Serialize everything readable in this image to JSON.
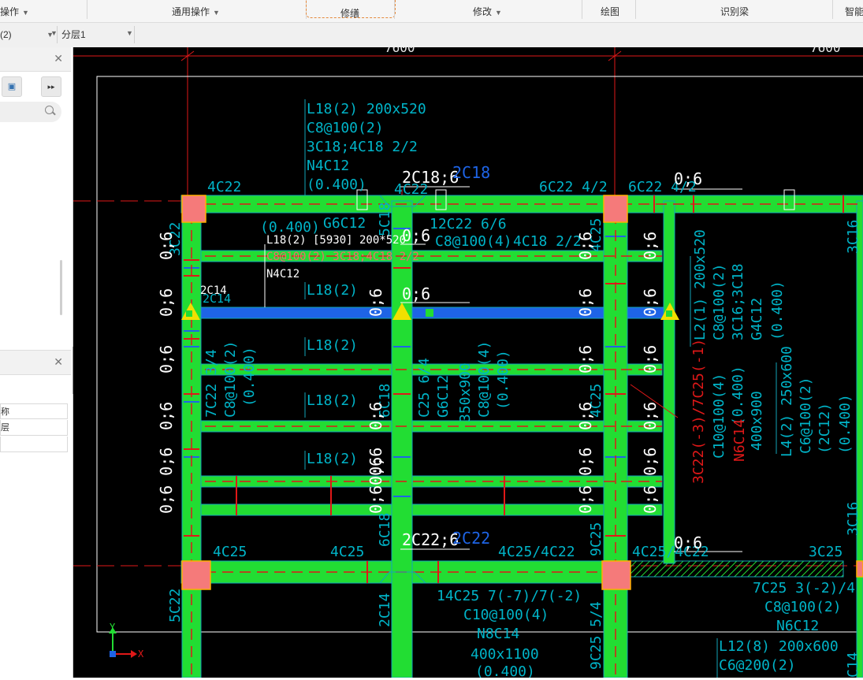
{
  "ribbon": {
    "groups": [
      {
        "label": "操作",
        "caret": true
      },
      {
        "label": "通用操作",
        "caret": true
      },
      {
        "label": "修缮",
        "caret": false
      },
      {
        "label": "修改",
        "caret": true
      },
      {
        "label": "绘图",
        "caret": false
      },
      {
        "label": "识别梁",
        "caret": false
      },
      {
        "label": "智能",
        "caret": false
      }
    ]
  },
  "toolbar": {
    "combo1_value": "(2)",
    "combo2_value": "分层1"
  },
  "left_panel": {
    "table_rows": [
      "称",
      "层",
      ""
    ]
  },
  "drawing": {
    "dims": {
      "left": "7600",
      "right": "7600"
    },
    "texts": {
      "t_l18_200x520": "L18(2) 200x520",
      "t_c8_100_2": "C8@100(2)",
      "t_3c18_4c18": "3C18;4C18 2/2",
      "t_n4c12": "N4C12",
      "t_0400_a": "(0.400)",
      "t_4c22_a": "4C22",
      "t_2c18_6": "2C18;6",
      "t_2c18_blue": "2C18",
      "t_4c22_b": "4C22",
      "t_6c22_42": "6C22 4/2",
      "t_6c22_42b": "6C22 4/2",
      "t_06_top": "0;6",
      "t_0400_b": "(0.400)",
      "t_g6c12": "G6C12",
      "t_12c22": "12C22 6/6",
      "t_c8_100_4": "C8@100(4)",
      "t_4c18_22": "4C18 2/2",
      "t_06_mid": "0;6",
      "t_hover_1": "L18(2) [5930] 200*520",
      "t_hover_2": "C8@100(2) 3C18;4C18 2/2",
      "t_hover_3": "N4C12",
      "t_2c14": "2C14",
      "t_2c14b": "2C14",
      "t_l18_a": "L18(2)",
      "t_06_blue": "0;6",
      "t_l18_b": "L18(2)",
      "t_l18_c": "L18(2)",
      "t_l18_d": "L18(2)",
      "t_7c22": "7C22 3/4",
      "t_c8_100_2b": "C8@100(2)",
      "t_0400_c": "(0.400)",
      "t_c25_64": "C25 6/4",
      "t_g6c12b": "G6C12",
      "t_350x900": "350x900",
      "t_c8_100_4b": "C8@100(4)",
      "t_0400_d": "(0.400)",
      "t_l2": "L2(1) 200x520",
      "t_c8_100_2c": "C8@100(2)",
      "t_3c16": "3C16;3C18",
      "t_g4c12": "G4C12",
      "t_0400_e": "(0.400)",
      "t_3c22": "3C22(-3)/7C25(-1)",
      "t_c10": "C10@100(4)",
      "t_n6c14": "N6C14",
      "t_0400_f": "(0.400)",
      "t_400x900": "400x900",
      "t_l4": "L4(2) 250x600",
      "t_c6_100": "C6@100(2)",
      "t_2c12": "(2C12)",
      "t_0400_g": "(0.400)",
      "t_3c16_r": "3C16",
      "t_3c16_r2": "3C16",
      "t_4c25_a": "4C25",
      "t_4c25_b": "4C25",
      "t_2c22_6": "2C22;6",
      "t_2c22_blue": "2C22",
      "t_4c25_4c22": "4C25/4C22",
      "t_4c25_4c22b": "4C25/4C22",
      "t_06_bot": "0;6",
      "t_3c25": "3C25",
      "t_14c25": "14C25 7(-7)/7(-2)",
      "t_c10b": "C10@100(4)",
      "t_n8c14": "N8C14",
      "t_400x1100": "400x1100",
      "t_0400_h": "(0.400)",
      "t_7c25": "7C25 3(-2)/4",
      "t_c8_100_2d": "C8@100(2)",
      "t_n6c12": "N6C12",
      "t_l12": "L12(8) 200x600",
      "t_c6_200": "C6@200(2)",
      "t_5c22": "5C22",
      "t_2c14v": "2C14",
      "t_9c25_54": "9C25 5/4",
      "t_c14r": "C14",
      "t_06_l1": "0;6",
      "t_06_l2": "0;6",
      "t_06_l3": "0;6",
      "t_06_l4": "0;6",
      "t_06_l5": "0;6 0;6",
      "t_06_c1": "0;6",
      "t_06_c2": "0;6",
      "t_06_c3": "0;6",
      "t_06_c4": "0;6 0;6",
      "t_06_r1": "0;6",
      "t_06_r2": "0;6",
      "t_06_r3": "0;6",
      "t_06_r4": "0;6",
      "t_06_r5": "0;6 0;6",
      "t_06_s1": "0;6",
      "t_06_s2": "0;6",
      "t_06_s3": "0;6",
      "t_06_s4": "0;6",
      "t_06_s5": "0;6 0;6",
      "t_3c22_l": "3C22",
      "t_6c18": "6C18",
      "t_5c18": "5C18",
      "t_4c25_v": "4C25",
      "t_4c25_v2": "4C25",
      "t_9c25": "9C25",
      "axis_x": "X",
      "axis_y": "Y"
    }
  },
  "colors": {
    "beam_green": "#22dd33",
    "beam_blue": "#1e64e6",
    "cyan_text": "#00b4c8",
    "red_axis": "#e01818",
    "column_fill": "#f57a7a"
  }
}
